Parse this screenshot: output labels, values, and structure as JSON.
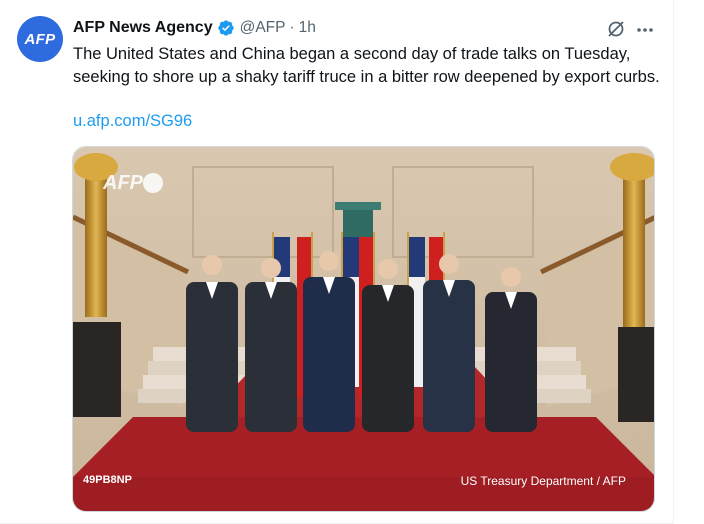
{
  "author": {
    "avatar_text": "AFP",
    "name": "AFP News Agency",
    "handle": "@AFP",
    "separator": "·",
    "time": "1h",
    "verified_color": "#1d9bf0"
  },
  "tweet": {
    "text": "The United States and China began a second day of trade talks on Tuesday, seeking to shore up a shaky tariff truce in a bitter row deepened by export curbs.",
    "link": "u.afp.com/SG96"
  },
  "media": {
    "watermark_left": "49PB8NP",
    "credit": "US Treasury Department / AFP",
    "logo_text": "AFP"
  },
  "colors": {
    "link": "#1d9bf0",
    "secondary_text": "#536471",
    "avatar_bg": "#2d6bde"
  },
  "icons": {
    "grok": "grok-icon",
    "more": "more-icon"
  }
}
